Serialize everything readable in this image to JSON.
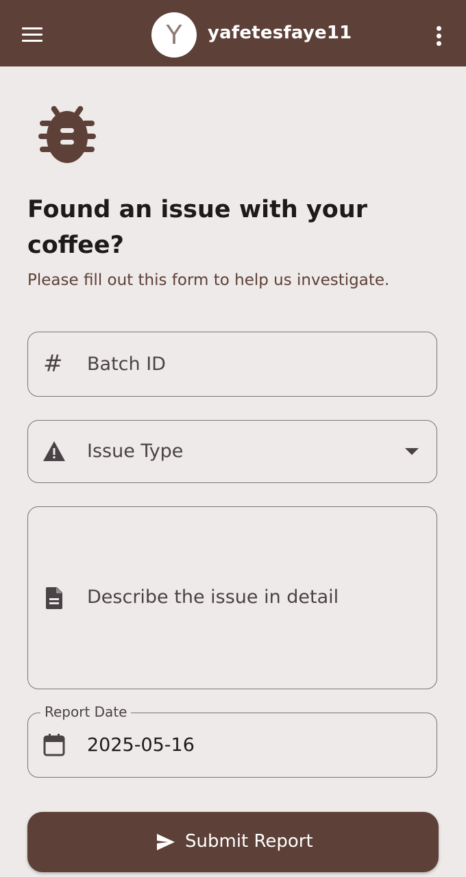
{
  "header": {
    "menu_icon": "hamburger-menu-icon",
    "avatar_initial": "Y",
    "username": "yafetesfaye11",
    "more_icon": "more-vert-icon",
    "background": "#5d4037"
  },
  "hero": {
    "icon": "bug-icon",
    "title": "Found an issue with your coffee?",
    "subtitle": "Please fill out this form to help us investigate."
  },
  "form": {
    "batch_id": {
      "icon": "hash-icon",
      "placeholder": "Batch ID"
    },
    "issue_type": {
      "icon": "warning-icon",
      "placeholder": "Issue Type"
    },
    "description": {
      "icon": "document-icon",
      "placeholder": "Describe the issue in detail"
    },
    "report_date": {
      "icon": "calendar-icon",
      "label": "Report Date",
      "value": "2025-05-16"
    }
  },
  "submit": {
    "icon": "send-icon",
    "label": "Submit Report",
    "background": "#5d4037"
  }
}
